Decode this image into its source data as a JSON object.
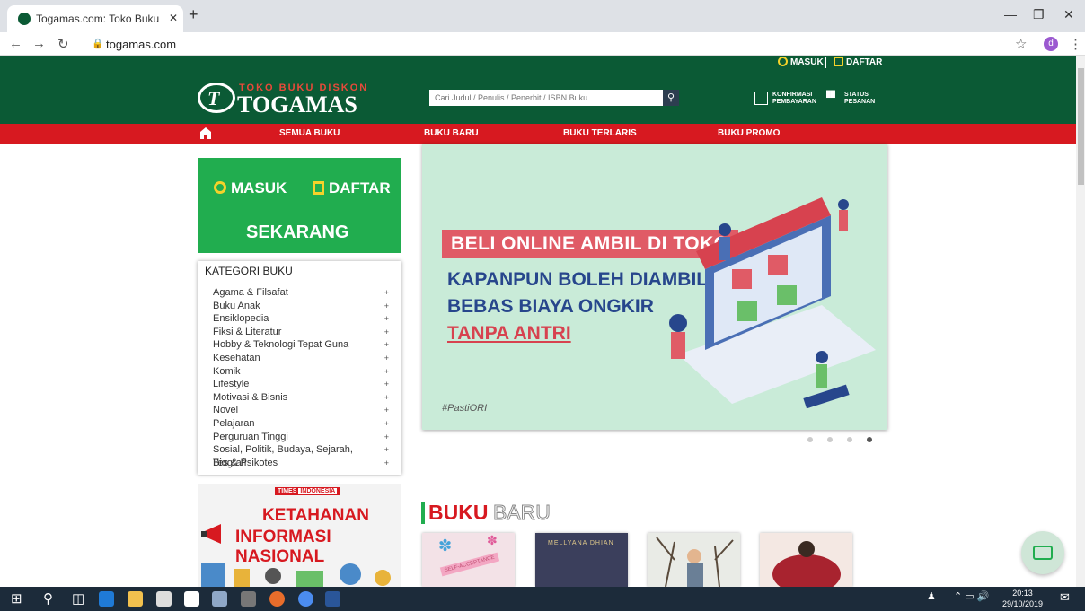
{
  "browser": {
    "tab_title": "Togamas.com: Toko Buku Online",
    "tab_close": "✕",
    "new_tab": "+",
    "url": "togamas.com",
    "profile_initial": "d"
  },
  "site": {
    "top_links": {
      "login": "MASUK",
      "register": "DAFTAR"
    },
    "logo": {
      "tagline": "TOKO BUKU DISKON",
      "name": "TOGAMAS"
    },
    "search_placeholder": "Cari Judul / Penulis / Penerbit / ISBN Buku",
    "header_links": [
      {
        "line1": "KONFIRMASI",
        "line2": "PEMBAYARAN"
      },
      {
        "line1": "STATUS",
        "line2": "PESANAN"
      }
    ],
    "nav": [
      "SEMUA BUKU",
      "BUKU BARU",
      "BUKU TERLARIS",
      "BUKU PROMO"
    ]
  },
  "cta": {
    "login": "MASUK",
    "register": "DAFTAR",
    "now": "SEKARANG"
  },
  "categories": {
    "title": "KATEGORI BUKU",
    "items": [
      "Agama & Filsafat",
      "Buku Anak",
      "Ensiklopedia",
      "Fiksi & Literatur",
      "Hobby & Teknologi Tepat Guna",
      "Kesehatan",
      "Komik",
      "Lifestyle",
      "Motivasi & Bisnis",
      "Novel",
      "Pelajaran",
      "Perguruan Tinggi",
      "Sosial, Politik, Budaya, Sejarah, Biografi",
      "Tes & Psikotes"
    ],
    "expand_symbol": "+"
  },
  "ad": {
    "badge_1": "TIMES",
    "badge_2": "INDONESIA",
    "line1": "KETAHANAN",
    "line2": "INFORMASI NASIONAL"
  },
  "banner": {
    "highlight": "BELI ONLINE AMBIL DI TOKO",
    "line2": "KAPANPUN BOLEH DIAMBIL",
    "line3": "BEBAS BIAYA ONGKIR",
    "line4": "TANPA ANTRI",
    "hashtag": "#PastiORI",
    "slide_count": 4,
    "active_slide": 4
  },
  "section": {
    "title_bold": "BUKU",
    "title_light": "BARU"
  },
  "books": [
    {
      "cover_text": "SELF-ACCEPTANCE"
    },
    {
      "cover_text": "MELLYANA DHIAN"
    },
    {
      "cover_text": ""
    },
    {
      "cover_text": ""
    }
  ],
  "taskbar": {
    "time": "20:13",
    "date": "29/10/2019"
  },
  "colors": {
    "brand_green": "#0b5a35",
    "nav_red": "#d71920",
    "cta_green": "#21ad4f",
    "banner_bg": "#c9ebd8",
    "banner_blue": "#27468c",
    "banner_pink": "#e05b66"
  }
}
